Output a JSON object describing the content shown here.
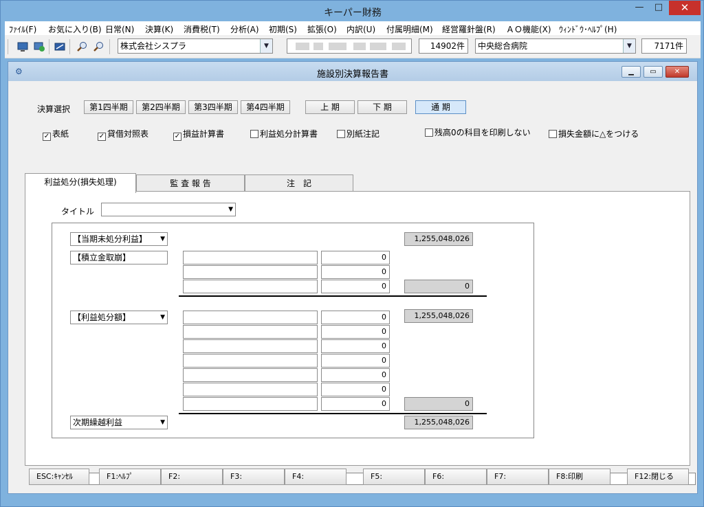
{
  "app": {
    "title": "キーパー財務",
    "min": "—",
    "max": "□",
    "close": "✕"
  },
  "menu": [
    "ﾌｧｲﾙ(F)",
    "お気に入り(B)",
    "日常(N)",
    "決算(K)",
    "消費税(T)",
    "分析(A)",
    "初期(S)",
    "拡張(O)",
    "内訳(U)",
    "付属明細(M)",
    "経営羅針盤(R)",
    "ＡＯ機能(X)",
    "ｳｨﾝﾄﾞｳ･ﾍﾙﾌﾟ(H)"
  ],
  "toolbar": {
    "company": "株式会社シスプラ",
    "count1": "14902件",
    "hospital": "中央総合病院",
    "count2": "7171件"
  },
  "dialog": {
    "title": "施設別決算報告書",
    "period_label": "決算選択",
    "quarters": [
      "第1四半期",
      "第2四半期",
      "第3四半期",
      "第4四半期"
    ],
    "halves": [
      "上 期",
      "下 期",
      "通 期"
    ],
    "selected_period": "通 期",
    "checks": [
      {
        "label": "表紙",
        "checked": true
      },
      {
        "label": "貸借対照表",
        "checked": true
      },
      {
        "label": "損益計算書",
        "checked": true
      },
      {
        "label": "利益処分計算書",
        "checked": false
      },
      {
        "label": "別紙注記",
        "checked": false
      },
      {
        "label": "残高0の科目を印刷しない",
        "checked": false
      },
      {
        "label": "損失金額に△をつける",
        "checked": false
      }
    ],
    "tabs": [
      "利益処分(損失処理)",
      "監 査 報 告",
      "注　記"
    ],
    "title_label": "タイトル",
    "title_value": "",
    "unappropriated_label": "【当期未処分利益】",
    "unappropriated_total": "1,255,048,026",
    "reserve_label": "【積立金取崩】",
    "reserve_values": [
      "0",
      "0",
      "0"
    ],
    "reserve_total": "0",
    "appropriation_label": "【利益処分額】",
    "appropriation_values": [
      "0",
      "0",
      "0",
      "0",
      "0",
      "0",
      "0"
    ],
    "appropriation_total_top": "1,255,048,026",
    "appropriation_total_bottom": "0",
    "carry_label": "次期繰越利益",
    "carry_total": "1,255,048,026"
  },
  "fkeys": [
    "ESC:ｷｬﾝｾﾙ",
    "F1:ﾍﾙﾌﾟ",
    "F2:",
    "F3:",
    "F4:",
    "F5:",
    "F6:",
    "F7:",
    "F8:印刷",
    "F12:閉じる"
  ]
}
